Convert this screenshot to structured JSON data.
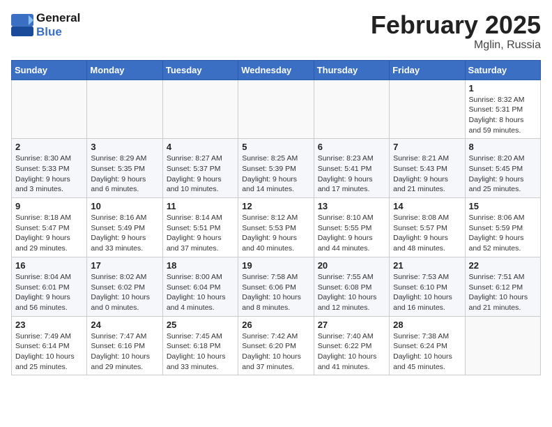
{
  "header": {
    "logo_line1": "General",
    "logo_line2": "Blue",
    "title": "February 2025",
    "subtitle": "Mglin, Russia"
  },
  "weekdays": [
    "Sunday",
    "Monday",
    "Tuesday",
    "Wednesday",
    "Thursday",
    "Friday",
    "Saturday"
  ],
  "weeks": [
    [
      {
        "day": "",
        "info": ""
      },
      {
        "day": "",
        "info": ""
      },
      {
        "day": "",
        "info": ""
      },
      {
        "day": "",
        "info": ""
      },
      {
        "day": "",
        "info": ""
      },
      {
        "day": "",
        "info": ""
      },
      {
        "day": "1",
        "info": "Sunrise: 8:32 AM\nSunset: 5:31 PM\nDaylight: 8 hours\nand 59 minutes."
      }
    ],
    [
      {
        "day": "2",
        "info": "Sunrise: 8:30 AM\nSunset: 5:33 PM\nDaylight: 9 hours\nand 3 minutes."
      },
      {
        "day": "3",
        "info": "Sunrise: 8:29 AM\nSunset: 5:35 PM\nDaylight: 9 hours\nand 6 minutes."
      },
      {
        "day": "4",
        "info": "Sunrise: 8:27 AM\nSunset: 5:37 PM\nDaylight: 9 hours\nand 10 minutes."
      },
      {
        "day": "5",
        "info": "Sunrise: 8:25 AM\nSunset: 5:39 PM\nDaylight: 9 hours\nand 14 minutes."
      },
      {
        "day": "6",
        "info": "Sunrise: 8:23 AM\nSunset: 5:41 PM\nDaylight: 9 hours\nand 17 minutes."
      },
      {
        "day": "7",
        "info": "Sunrise: 8:21 AM\nSunset: 5:43 PM\nDaylight: 9 hours\nand 21 minutes."
      },
      {
        "day": "8",
        "info": "Sunrise: 8:20 AM\nSunset: 5:45 PM\nDaylight: 9 hours\nand 25 minutes."
      }
    ],
    [
      {
        "day": "9",
        "info": "Sunrise: 8:18 AM\nSunset: 5:47 PM\nDaylight: 9 hours\nand 29 minutes."
      },
      {
        "day": "10",
        "info": "Sunrise: 8:16 AM\nSunset: 5:49 PM\nDaylight: 9 hours\nand 33 minutes."
      },
      {
        "day": "11",
        "info": "Sunrise: 8:14 AM\nSunset: 5:51 PM\nDaylight: 9 hours\nand 37 minutes."
      },
      {
        "day": "12",
        "info": "Sunrise: 8:12 AM\nSunset: 5:53 PM\nDaylight: 9 hours\nand 40 minutes."
      },
      {
        "day": "13",
        "info": "Sunrise: 8:10 AM\nSunset: 5:55 PM\nDaylight: 9 hours\nand 44 minutes."
      },
      {
        "day": "14",
        "info": "Sunrise: 8:08 AM\nSunset: 5:57 PM\nDaylight: 9 hours\nand 48 minutes."
      },
      {
        "day": "15",
        "info": "Sunrise: 8:06 AM\nSunset: 5:59 PM\nDaylight: 9 hours\nand 52 minutes."
      }
    ],
    [
      {
        "day": "16",
        "info": "Sunrise: 8:04 AM\nSunset: 6:01 PM\nDaylight: 9 hours\nand 56 minutes."
      },
      {
        "day": "17",
        "info": "Sunrise: 8:02 AM\nSunset: 6:02 PM\nDaylight: 10 hours\nand 0 minutes."
      },
      {
        "day": "18",
        "info": "Sunrise: 8:00 AM\nSunset: 6:04 PM\nDaylight: 10 hours\nand 4 minutes."
      },
      {
        "day": "19",
        "info": "Sunrise: 7:58 AM\nSunset: 6:06 PM\nDaylight: 10 hours\nand 8 minutes."
      },
      {
        "day": "20",
        "info": "Sunrise: 7:55 AM\nSunset: 6:08 PM\nDaylight: 10 hours\nand 12 minutes."
      },
      {
        "day": "21",
        "info": "Sunrise: 7:53 AM\nSunset: 6:10 PM\nDaylight: 10 hours\nand 16 minutes."
      },
      {
        "day": "22",
        "info": "Sunrise: 7:51 AM\nSunset: 6:12 PM\nDaylight: 10 hours\nand 21 minutes."
      }
    ],
    [
      {
        "day": "23",
        "info": "Sunrise: 7:49 AM\nSunset: 6:14 PM\nDaylight: 10 hours\nand 25 minutes."
      },
      {
        "day": "24",
        "info": "Sunrise: 7:47 AM\nSunset: 6:16 PM\nDaylight: 10 hours\nand 29 minutes."
      },
      {
        "day": "25",
        "info": "Sunrise: 7:45 AM\nSunset: 6:18 PM\nDaylight: 10 hours\nand 33 minutes."
      },
      {
        "day": "26",
        "info": "Sunrise: 7:42 AM\nSunset: 6:20 PM\nDaylight: 10 hours\nand 37 minutes."
      },
      {
        "day": "27",
        "info": "Sunrise: 7:40 AM\nSunset: 6:22 PM\nDaylight: 10 hours\nand 41 minutes."
      },
      {
        "day": "28",
        "info": "Sunrise: 7:38 AM\nSunset: 6:24 PM\nDaylight: 10 hours\nand 45 minutes."
      },
      {
        "day": "",
        "info": ""
      }
    ]
  ]
}
